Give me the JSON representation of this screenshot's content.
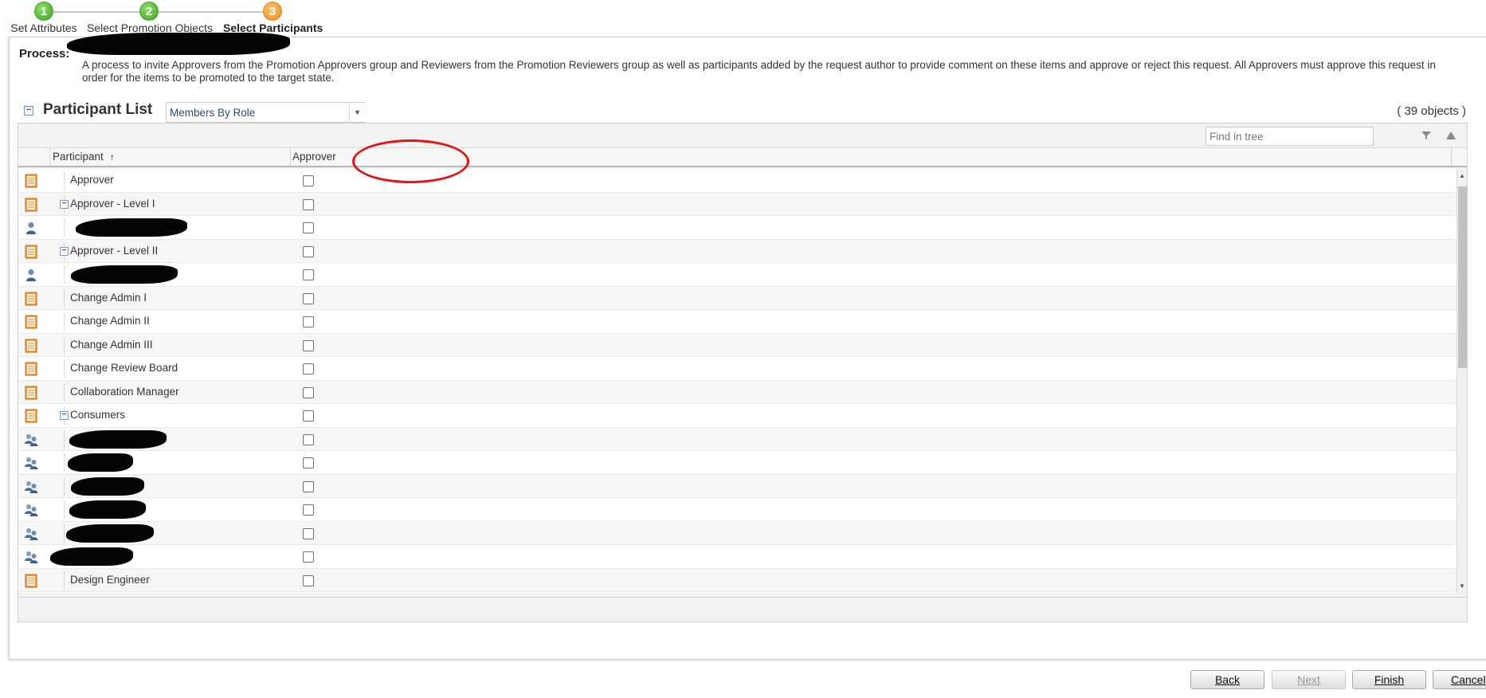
{
  "wizard": {
    "steps": [
      {
        "number": "1",
        "label": "Set Attributes",
        "state": "done"
      },
      {
        "number": "2",
        "label": "Select Promotion Objects",
        "state": "done"
      },
      {
        "number": "3",
        "label": "Select Participants",
        "state": "current"
      }
    ]
  },
  "process": {
    "label": "Process:",
    "description_line1": "A process to invite Approvers from the Promotion Approvers  group and Reviewers from the Promotion Reviewers group as well as participants added by the request author to provide comment on these items and approve or reject this request. All Approvers must approve this request in",
    "description_line2": "order for the items to be promoted to the target state."
  },
  "participant_list": {
    "title": "Participant List",
    "view_select": "Members By Role",
    "object_count": "( 39 objects )",
    "find_placeholder": "Find in tree",
    "columns": {
      "participant": "Participant",
      "sort_indicator": "↑",
      "approver": "Approver"
    },
    "rows": [
      {
        "type": "role",
        "label": "Approver",
        "expanded": false
      },
      {
        "type": "role",
        "label": "Approver - Level I",
        "expanded": true
      },
      {
        "type": "user",
        "label": ""
      },
      {
        "type": "role",
        "label": "Approver - Level II",
        "expanded": true
      },
      {
        "type": "user",
        "label": ""
      },
      {
        "type": "role",
        "label": "Change Admin I",
        "expanded": false
      },
      {
        "type": "role",
        "label": "Change Admin II",
        "expanded": false
      },
      {
        "type": "role",
        "label": "Change Admin III",
        "expanded": false
      },
      {
        "type": "role",
        "label": "Change Review Board",
        "expanded": false
      },
      {
        "type": "role",
        "label": "Collaboration Manager",
        "expanded": false
      },
      {
        "type": "role",
        "label": "Consumers",
        "expanded": true
      },
      {
        "type": "group",
        "label": ""
      },
      {
        "type": "group",
        "label": ""
      },
      {
        "type": "group",
        "label": ""
      },
      {
        "type": "group",
        "label": ""
      },
      {
        "type": "group",
        "label": ""
      },
      {
        "type": "group",
        "label": ""
      },
      {
        "type": "role",
        "label": "Design Engineer",
        "expanded": false
      }
    ]
  },
  "buttons": {
    "back": "Back",
    "next": "Next",
    "finish": "Finish",
    "cancel": "Cancel"
  },
  "icons": {
    "role": "role-icon",
    "user": "user-icon",
    "group": "group-icon"
  },
  "colors": {
    "step_done": "#3aa21a",
    "step_current": "#f08a14",
    "annotation": "#e01515"
  }
}
